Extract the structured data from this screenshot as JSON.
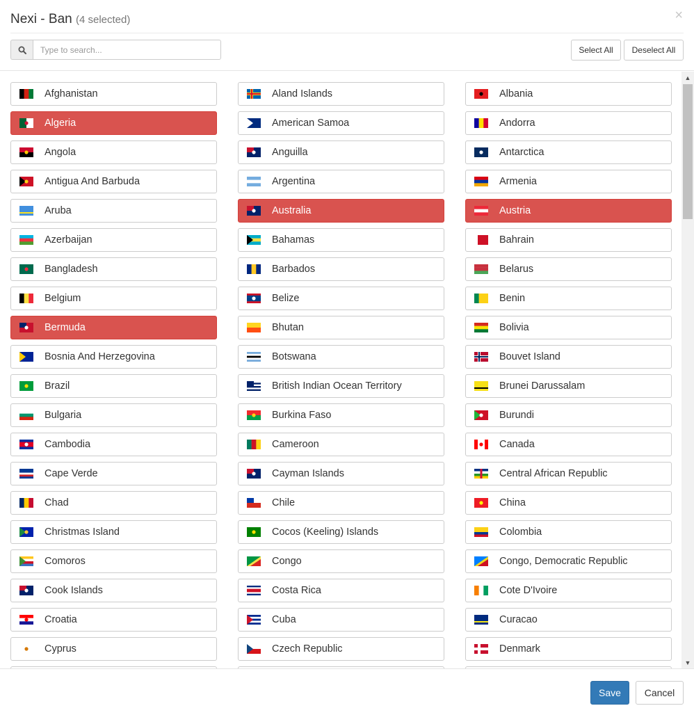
{
  "header": {
    "title": "Nexi - Ban",
    "selected_count": "(4 selected)",
    "close_glyph": "×"
  },
  "search": {
    "placeholder": "Type to search...",
    "value": ""
  },
  "toolbar": {
    "select_all": "Select All",
    "deselect_all": "Deselect All"
  },
  "footer": {
    "save": "Save",
    "cancel": "Cancel"
  },
  "colors": {
    "selected": "#d9534f",
    "primary": "#337ab7"
  },
  "countries": [
    {
      "name": "Afghanistan",
      "selected": false,
      "flag": [
        [
          "v",
          "#000000",
          "#d32011",
          "#007a36"
        ]
      ]
    },
    {
      "name": "Aland Islands",
      "selected": false,
      "flag": [
        [
          "bg",
          "#0064ad"
        ],
        [
          "cross",
          "#ffce00",
          "#d21034"
        ]
      ]
    },
    {
      "name": "Albania",
      "selected": false,
      "flag": [
        [
          "bg",
          "#e41e20"
        ],
        [
          "dot",
          "#000000"
        ]
      ]
    },
    {
      "name": "Algeria",
      "selected": true,
      "flag": [
        [
          "v",
          "#006233",
          "#ffffff"
        ],
        [
          "dot",
          "#d21034"
        ]
      ]
    },
    {
      "name": "American Samoa",
      "selected": false,
      "flag": [
        [
          "bg",
          "#002b7f"
        ],
        [
          "tri",
          "#ffffff"
        ]
      ]
    },
    {
      "name": "Andorra",
      "selected": false,
      "flag": [
        [
          "v",
          "#10069f",
          "#fedd00",
          "#d50032"
        ]
      ]
    },
    {
      "name": "Angola",
      "selected": false,
      "flag": [
        [
          "h",
          "#cc092f",
          "#000000"
        ],
        [
          "dot",
          "#ffcb00"
        ]
      ]
    },
    {
      "name": "Anguilla",
      "selected": false,
      "flag": [
        [
          "bg",
          "#012169"
        ],
        [
          "canton",
          "#c8102e"
        ],
        [
          "dot",
          "#ffffff"
        ]
      ]
    },
    {
      "name": "Antarctica",
      "selected": false,
      "flag": [
        [
          "bg",
          "#072b5f"
        ],
        [
          "dot",
          "#ffffff"
        ]
      ]
    },
    {
      "name": "Antigua And Barbuda",
      "selected": false,
      "flag": [
        [
          "bg",
          "#ce1126"
        ],
        [
          "tri",
          "#000000"
        ],
        [
          "dot",
          "#fcd116"
        ]
      ]
    },
    {
      "name": "Argentina",
      "selected": false,
      "flag": [
        [
          "h",
          "#74acdf",
          "#ffffff",
          "#74acdf"
        ]
      ]
    },
    {
      "name": "Armenia",
      "selected": false,
      "flag": [
        [
          "h",
          "#d90012",
          "#0033a0",
          "#f2a800"
        ]
      ]
    },
    {
      "name": "Aruba",
      "selected": false,
      "flag": [
        [
          "bg",
          "#418fde"
        ],
        [
          "band",
          "#fbe122"
        ]
      ]
    },
    {
      "name": "Australia",
      "selected": true,
      "flag": [
        [
          "bg",
          "#012169"
        ],
        [
          "canton",
          "#c8102e"
        ],
        [
          "dot",
          "#ffffff"
        ]
      ]
    },
    {
      "name": "Austria",
      "selected": true,
      "flag": [
        [
          "h",
          "#ed2939",
          "#ffffff",
          "#ed2939"
        ]
      ]
    },
    {
      "name": "Azerbaijan",
      "selected": false,
      "flag": [
        [
          "h",
          "#00b5e2",
          "#ef3340",
          "#509e2f"
        ]
      ]
    },
    {
      "name": "Bahamas",
      "selected": false,
      "flag": [
        [
          "h",
          "#00abc9",
          "#fae042",
          "#00abc9"
        ],
        [
          "tri",
          "#000000"
        ]
      ]
    },
    {
      "name": "Bahrain",
      "selected": false,
      "flag": [
        [
          "v",
          "#ffffff",
          "#ce1126",
          "#ce1126",
          "#ce1126"
        ]
      ]
    },
    {
      "name": "Bangladesh",
      "selected": false,
      "flag": [
        [
          "bg",
          "#006a4e"
        ],
        [
          "dot",
          "#f42a41"
        ]
      ]
    },
    {
      "name": "Barbados",
      "selected": false,
      "flag": [
        [
          "v",
          "#00267f",
          "#ffc726",
          "#00267f"
        ]
      ]
    },
    {
      "name": "Belarus",
      "selected": false,
      "flag": [
        [
          "h",
          "#c8313e",
          "#c8313e",
          "#4aa657"
        ]
      ]
    },
    {
      "name": "Belgium",
      "selected": false,
      "flag": [
        [
          "v",
          "#000000",
          "#fae042",
          "#ed2939"
        ]
      ]
    },
    {
      "name": "Belize",
      "selected": false,
      "flag": [
        [
          "h",
          "#ce1126",
          "#003f87",
          "#003f87",
          "#003f87",
          "#ce1126"
        ],
        [
          "dot",
          "#ffffff"
        ]
      ]
    },
    {
      "name": "Benin",
      "selected": false,
      "flag": [
        [
          "v",
          "#008751",
          "#fcd116",
          "#fcd116"
        ]
      ]
    },
    {
      "name": "Bermuda",
      "selected": true,
      "flag": [
        [
          "bg",
          "#c8102e"
        ],
        [
          "canton",
          "#012169"
        ],
        [
          "dot",
          "#ffffff"
        ]
      ]
    },
    {
      "name": "Bhutan",
      "selected": false,
      "flag": [
        [
          "h",
          "#ffd520",
          "#ff4e12"
        ]
      ]
    },
    {
      "name": "Bolivia",
      "selected": false,
      "flag": [
        [
          "h",
          "#d52b1e",
          "#f9e300",
          "#007934"
        ]
      ]
    },
    {
      "name": "Bosnia And Herzegovina",
      "selected": false,
      "flag": [
        [
          "bg",
          "#002395"
        ],
        [
          "tri",
          "#fecb00"
        ]
      ]
    },
    {
      "name": "Botswana",
      "selected": false,
      "flag": [
        [
          "h",
          "#75aadb",
          "#ffffff",
          "#000000",
          "#ffffff",
          "#75aadb"
        ]
      ]
    },
    {
      "name": "Bouvet Island",
      "selected": false,
      "flag": [
        [
          "bg",
          "#ba0c2f"
        ],
        [
          "cross",
          "#ffffff",
          "#00205b"
        ]
      ]
    },
    {
      "name": "Brazil",
      "selected": false,
      "flag": [
        [
          "bg",
          "#009c3b"
        ],
        [
          "dot",
          "#ffdf00"
        ]
      ]
    },
    {
      "name": "British Indian Ocean Territory",
      "selected": false,
      "flag": [
        [
          "h",
          "#ffffff",
          "#012169",
          "#ffffff",
          "#012169",
          "#ffffff",
          "#012169"
        ],
        [
          "canton",
          "#012169"
        ]
      ]
    },
    {
      "name": "Brunei Darussalam",
      "selected": false,
      "flag": [
        [
          "bg",
          "#f7e017"
        ],
        [
          "band",
          "#000000"
        ]
      ]
    },
    {
      "name": "Bulgaria",
      "selected": false,
      "flag": [
        [
          "h",
          "#ffffff",
          "#00966e",
          "#d62612"
        ]
      ]
    },
    {
      "name": "Burkina Faso",
      "selected": false,
      "flag": [
        [
          "h",
          "#ef2b2d",
          "#009e49"
        ],
        [
          "dot",
          "#fcd116"
        ]
      ]
    },
    {
      "name": "Burundi",
      "selected": false,
      "flag": [
        [
          "bg",
          "#ce1126"
        ],
        [
          "tri",
          "#1eb53a"
        ],
        [
          "dot",
          "#ffffff"
        ]
      ]
    },
    {
      "name": "Cambodia",
      "selected": false,
      "flag": [
        [
          "h",
          "#032ea1",
          "#e00025",
          "#e00025",
          "#032ea1"
        ],
        [
          "dot",
          "#ffffff"
        ]
      ]
    },
    {
      "name": "Cameroon",
      "selected": false,
      "flag": [
        [
          "v",
          "#007a5e",
          "#ce1126",
          "#fcd116"
        ]
      ]
    },
    {
      "name": "Canada",
      "selected": false,
      "flag": [
        [
          "v",
          "#ff0000",
          "#ffffff",
          "#ffffff",
          "#ff0000"
        ],
        [
          "dot",
          "#ff0000"
        ]
      ]
    },
    {
      "name": "Cape Verde",
      "selected": false,
      "flag": [
        [
          "h",
          "#003893",
          "#003893",
          "#ffffff",
          "#cf2027",
          "#003893"
        ]
      ]
    },
    {
      "name": "Cayman Islands",
      "selected": false,
      "flag": [
        [
          "bg",
          "#012169"
        ],
        [
          "canton",
          "#c8102e"
        ],
        [
          "dot",
          "#ffffff"
        ]
      ]
    },
    {
      "name": "Central African Republic",
      "selected": false,
      "flag": [
        [
          "h",
          "#003082",
          "#ffffff",
          "#289728",
          "#ffce00"
        ],
        [
          "vband",
          "#d21034"
        ]
      ]
    },
    {
      "name": "Chad",
      "selected": false,
      "flag": [
        [
          "v",
          "#002664",
          "#fecb00",
          "#c60c30"
        ]
      ]
    },
    {
      "name": "Chile",
      "selected": false,
      "flag": [
        [
          "h",
          "#ffffff",
          "#d52b1e"
        ],
        [
          "canton",
          "#0039a6"
        ]
      ]
    },
    {
      "name": "China",
      "selected": false,
      "flag": [
        [
          "bg",
          "#ee1c25"
        ],
        [
          "canton",
          "#ee1c25"
        ],
        [
          "dot",
          "#ffff00"
        ]
      ]
    },
    {
      "name": "Christmas Island",
      "selected": false,
      "flag": [
        [
          "bg",
          "#0021ad"
        ],
        [
          "tri",
          "#1c8a42"
        ],
        [
          "dot",
          "#ffc639"
        ]
      ]
    },
    {
      "name": "Cocos (Keeling) Islands",
      "selected": false,
      "flag": [
        [
          "bg",
          "#008000"
        ],
        [
          "dot",
          "#ffe000"
        ]
      ]
    },
    {
      "name": "Colombia",
      "selected": false,
      "flag": [
        [
          "h",
          "#fcd116",
          "#fcd116",
          "#003893",
          "#ce1126"
        ]
      ]
    },
    {
      "name": "Comoros",
      "selected": false,
      "flag": [
        [
          "h",
          "#ffc61e",
          "#ffffff",
          "#ce1126",
          "#3a75c4"
        ],
        [
          "tri",
          "#3d8e33"
        ]
      ]
    },
    {
      "name": "Congo",
      "selected": false,
      "flag": [
        [
          "bg",
          "#009543"
        ],
        [
          "diag",
          "#fbde4a",
          "#dc241f"
        ]
      ]
    },
    {
      "name": "Congo, Democratic Republic",
      "selected": false,
      "flag": [
        [
          "bg",
          "#007fff"
        ],
        [
          "diag",
          "#f7d618",
          "#ce1021"
        ]
      ]
    },
    {
      "name": "Cook Islands",
      "selected": false,
      "flag": [
        [
          "bg",
          "#012169"
        ],
        [
          "canton",
          "#c8102e"
        ],
        [
          "dot",
          "#ffffff"
        ]
      ]
    },
    {
      "name": "Costa Rica",
      "selected": false,
      "flag": [
        [
          "h",
          "#002b7f",
          "#ffffff",
          "#ce1126",
          "#ce1126",
          "#ffffff",
          "#002b7f"
        ]
      ]
    },
    {
      "name": "Cote D'Ivoire",
      "selected": false,
      "flag": [
        [
          "v",
          "#f77f00",
          "#ffffff",
          "#009e60"
        ]
      ]
    },
    {
      "name": "Croatia",
      "selected": false,
      "flag": [
        [
          "h",
          "#ff0000",
          "#ffffff",
          "#171796"
        ],
        [
          "dot",
          "#ff0000"
        ]
      ]
    },
    {
      "name": "Cuba",
      "selected": false,
      "flag": [
        [
          "h",
          "#002a8f",
          "#ffffff",
          "#002a8f",
          "#ffffff",
          "#002a8f"
        ],
        [
          "tri",
          "#cf142b"
        ]
      ]
    },
    {
      "name": "Curacao",
      "selected": false,
      "flag": [
        [
          "bg",
          "#002b7f"
        ],
        [
          "band",
          "#f9e814"
        ]
      ]
    },
    {
      "name": "Cyprus",
      "selected": false,
      "flag": [
        [
          "bg",
          "#ffffff"
        ],
        [
          "dot",
          "#d57800"
        ]
      ]
    },
    {
      "name": "Czech Republic",
      "selected": false,
      "flag": [
        [
          "h",
          "#ffffff",
          "#d7141a"
        ],
        [
          "tri",
          "#11457e"
        ]
      ]
    },
    {
      "name": "Denmark",
      "selected": false,
      "flag": [
        [
          "bg",
          "#c8102e"
        ],
        [
          "cross",
          "#ffffff",
          "#ffffff"
        ]
      ]
    },
    {
      "name": "",
      "selected": false,
      "flag": []
    },
    {
      "name": "",
      "selected": false,
      "flag": []
    },
    {
      "name": "",
      "selected": false,
      "flag": []
    }
  ]
}
